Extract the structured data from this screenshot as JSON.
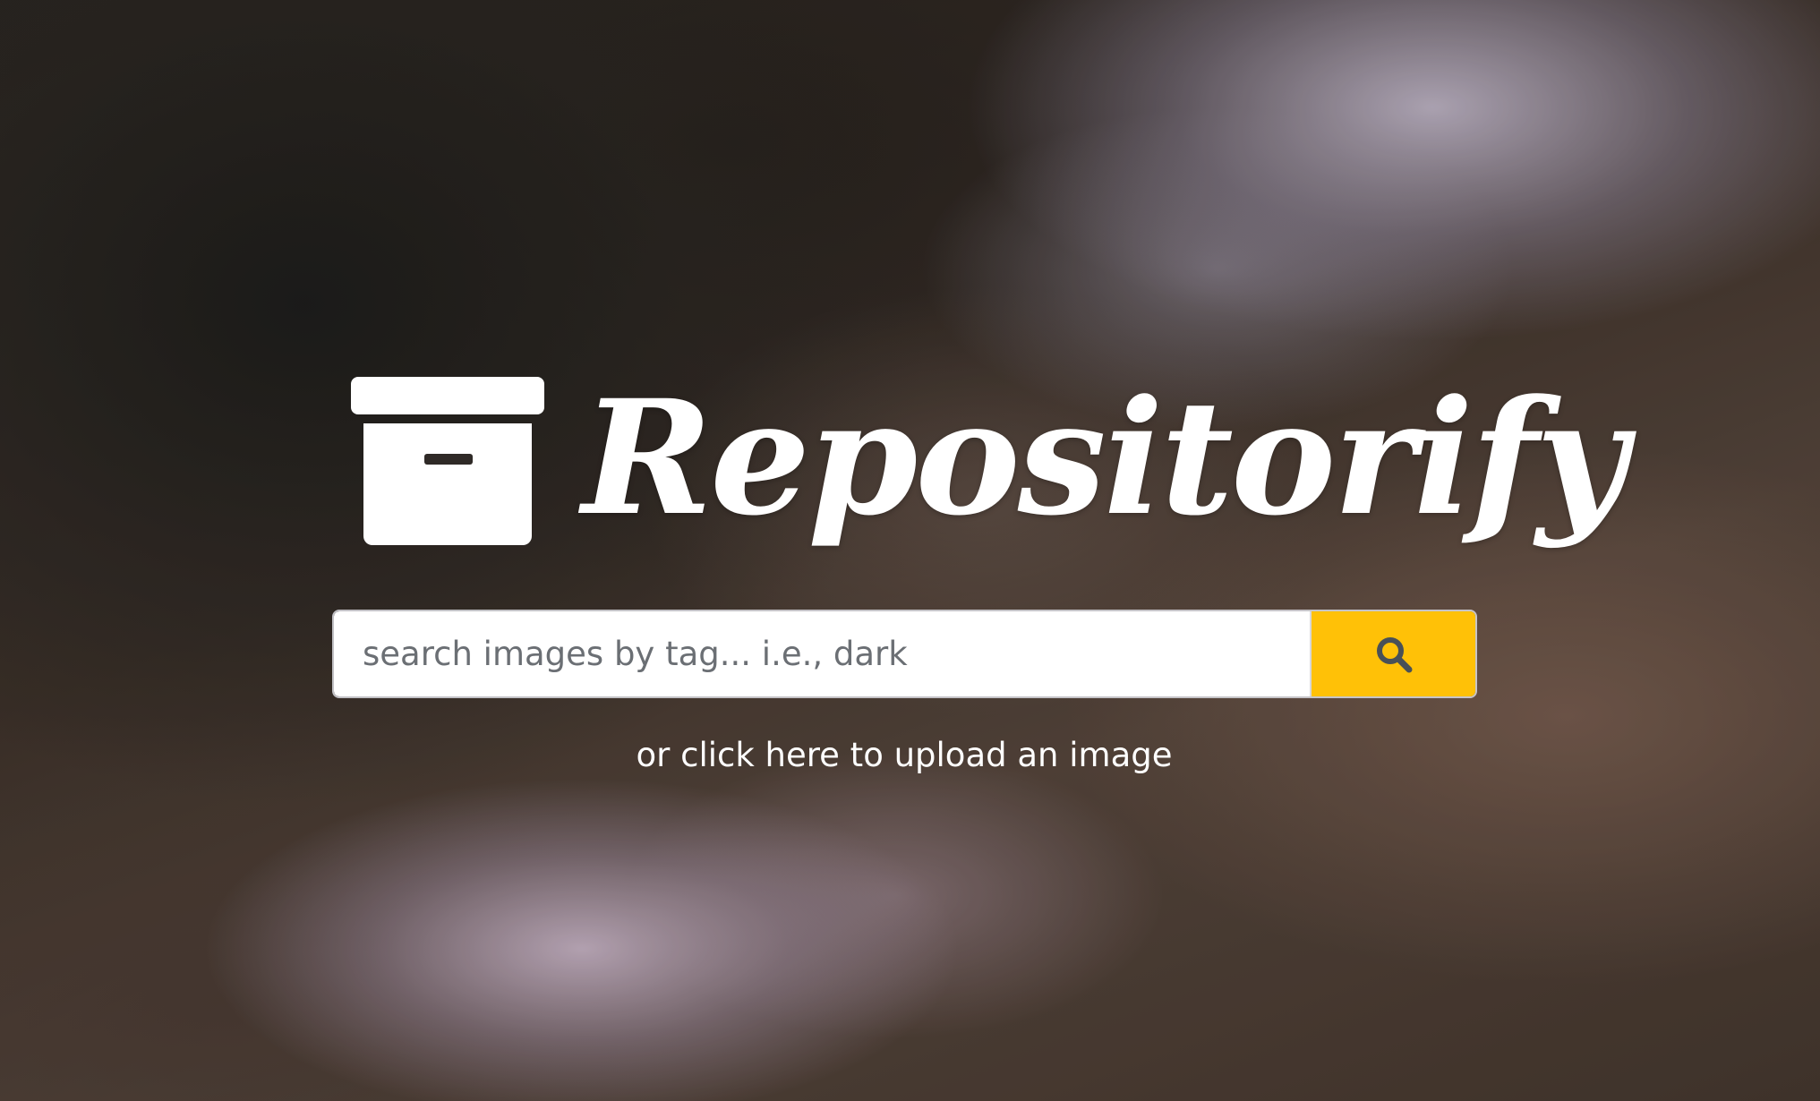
{
  "brand": {
    "name": "Repositorify",
    "logo_icon": "archive-box-icon",
    "text_color": "#ffffff"
  },
  "search": {
    "placeholder": "search images by tag... i.e., dark",
    "value": "",
    "button_icon": "search-icon",
    "button_color": "#ffc107",
    "icon_color": "#495057"
  },
  "upload": {
    "link_text": "or click here to upload an image"
  }
}
